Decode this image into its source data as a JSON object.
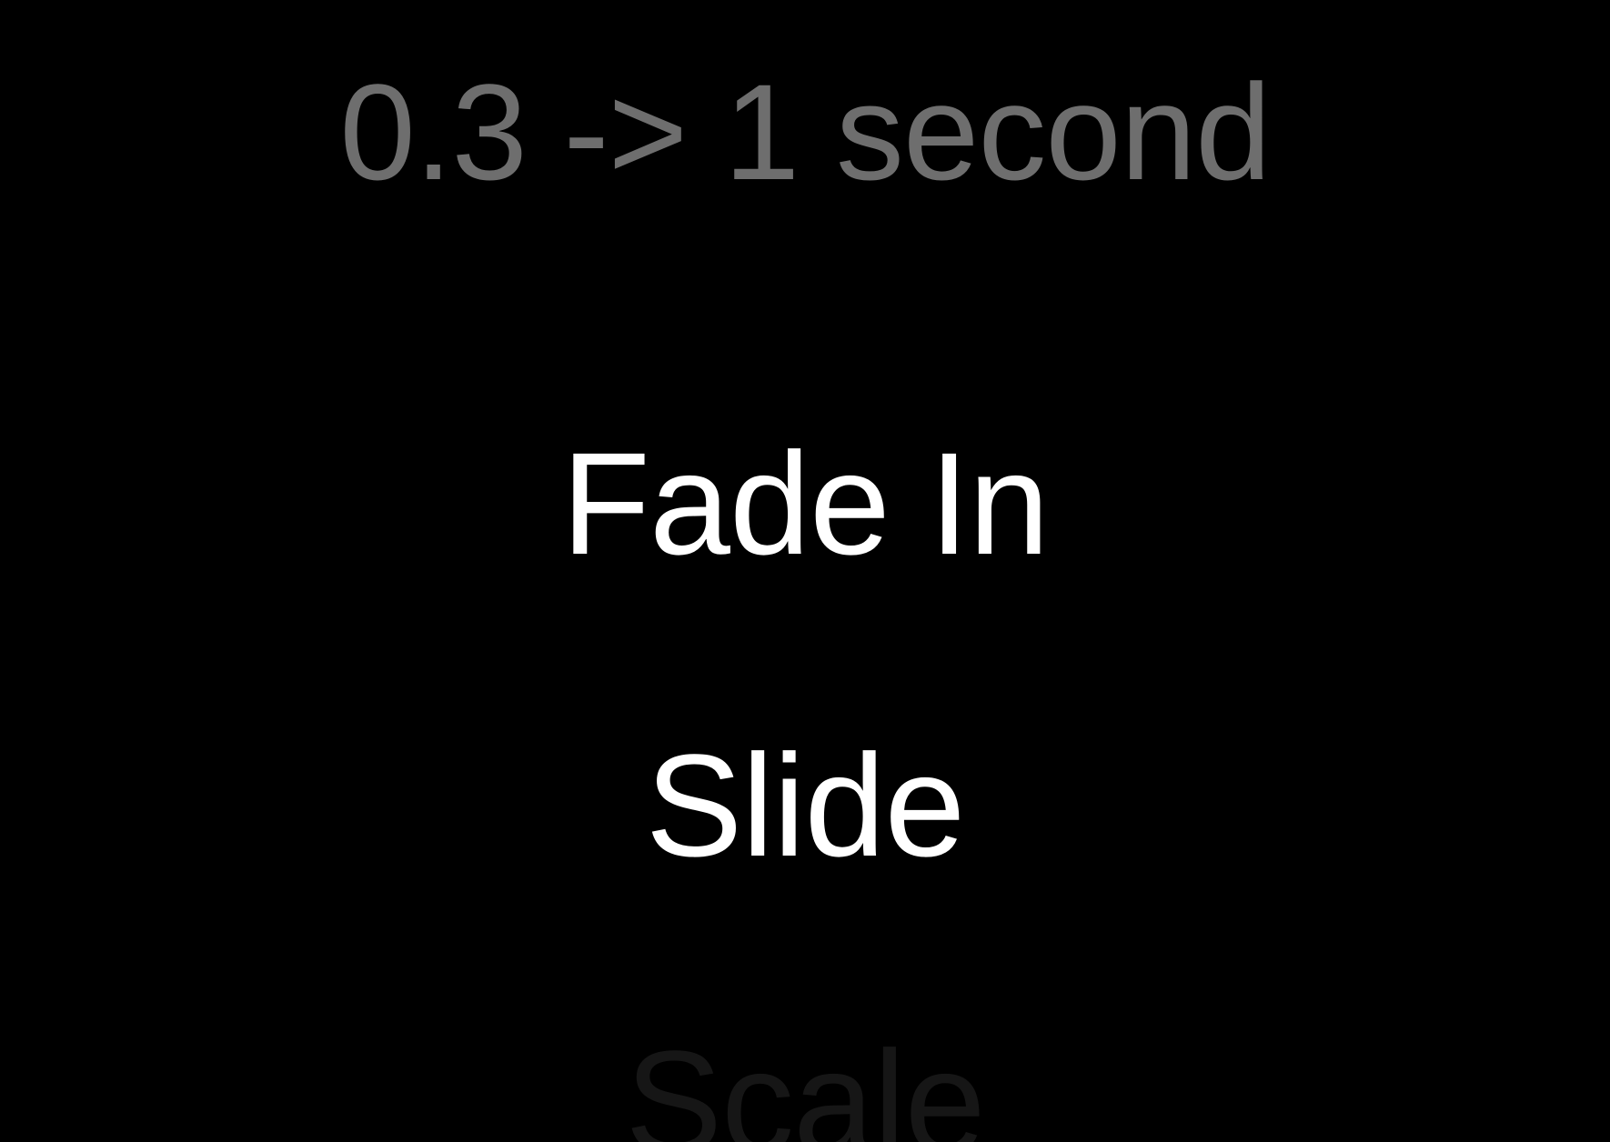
{
  "header": {
    "duration_label": "0.3 -> 1 second"
  },
  "list": {
    "items": [
      {
        "label": "Fade In",
        "state": "visible"
      },
      {
        "label": "Slide",
        "state": "visible"
      },
      {
        "label": "Scale",
        "state": "fading-in"
      }
    ]
  },
  "colors": {
    "background": "#000000",
    "primary_text": "#ffffff",
    "secondary_text": "#6e6e6e",
    "faded_text": "#161616"
  }
}
